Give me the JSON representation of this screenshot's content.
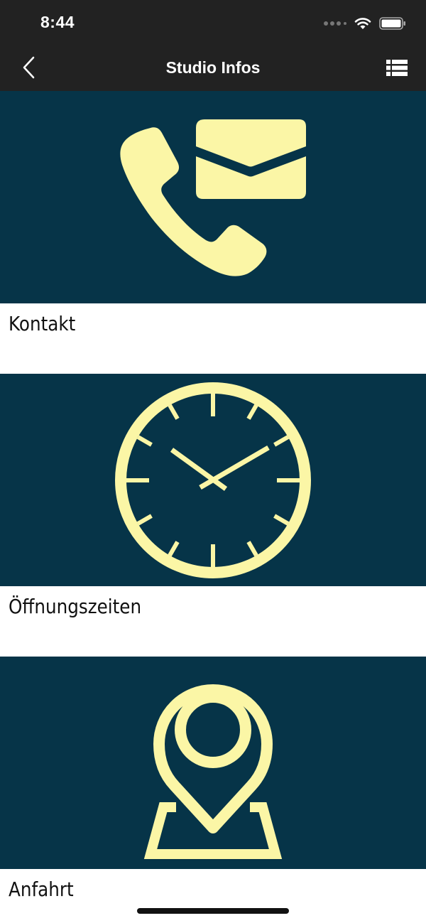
{
  "status_bar": {
    "time": "8:44"
  },
  "nav": {
    "title": "Studio Infos",
    "back_icon": "chevron-left-icon",
    "menu_icon": "list-view-icon"
  },
  "tiles": [
    {
      "label": "Kontakt",
      "icon": "phone-mail-icon"
    },
    {
      "label": "Öffnungszeiten",
      "icon": "clock-icon"
    },
    {
      "label": "Anfahrt",
      "icon": "map-pin-icon"
    }
  ],
  "colors": {
    "bar_background": "#222222",
    "tile_background": "#063448",
    "icon_color": "#FBF6A6",
    "caption_text": "#111111"
  }
}
